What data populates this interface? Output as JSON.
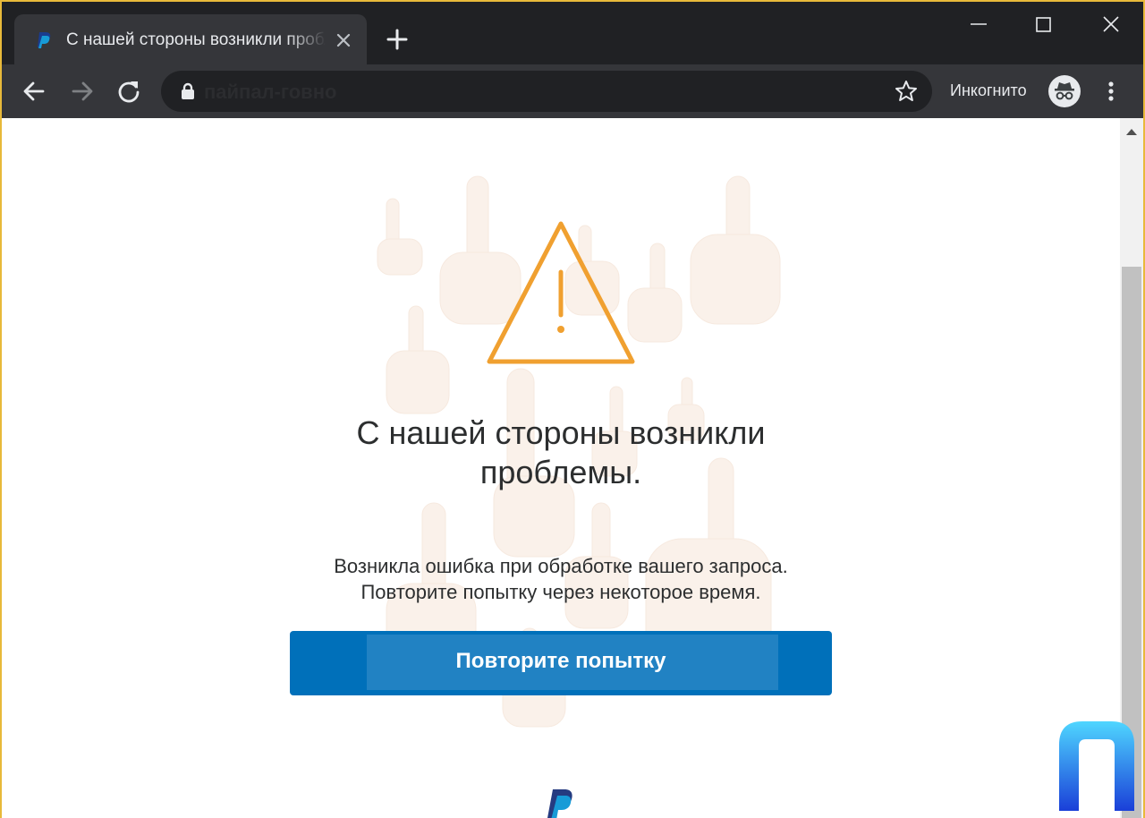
{
  "browser": {
    "tab": {
      "title": "С нашей стороны возникли проблемы."
    },
    "address_bar": {
      "url": "пайпал-говно"
    },
    "incognito_label": "Инкогнито"
  },
  "page": {
    "headline_line1": "С нашей стороны возникли",
    "headline_line2": "проблемы.",
    "description_line1": "Возникла ошибка при обработке вашего запроса.",
    "description_line2": "Повторите попытку через некоторое время.",
    "retry_button": "Повторите попытку"
  },
  "icons": {
    "tab_favicon": "paypal-icon",
    "tab_close": "close-icon",
    "new_tab": "plus-icon",
    "back": "arrow-left-icon",
    "forward": "arrow-right-icon",
    "reload": "reload-icon",
    "lock": "lock-icon",
    "bookmark": "star-icon",
    "incognito": "incognito-icon",
    "menu": "kebab-menu-icon",
    "warning": "warning-triangle-icon",
    "footer_logo": "paypal-logo-icon"
  },
  "colors": {
    "accent": "#0070ba",
    "warning": "#f0a030",
    "browser_dark": "#202124",
    "browser_toolbar": "#35363a",
    "frame_border": "#e8b93a"
  }
}
